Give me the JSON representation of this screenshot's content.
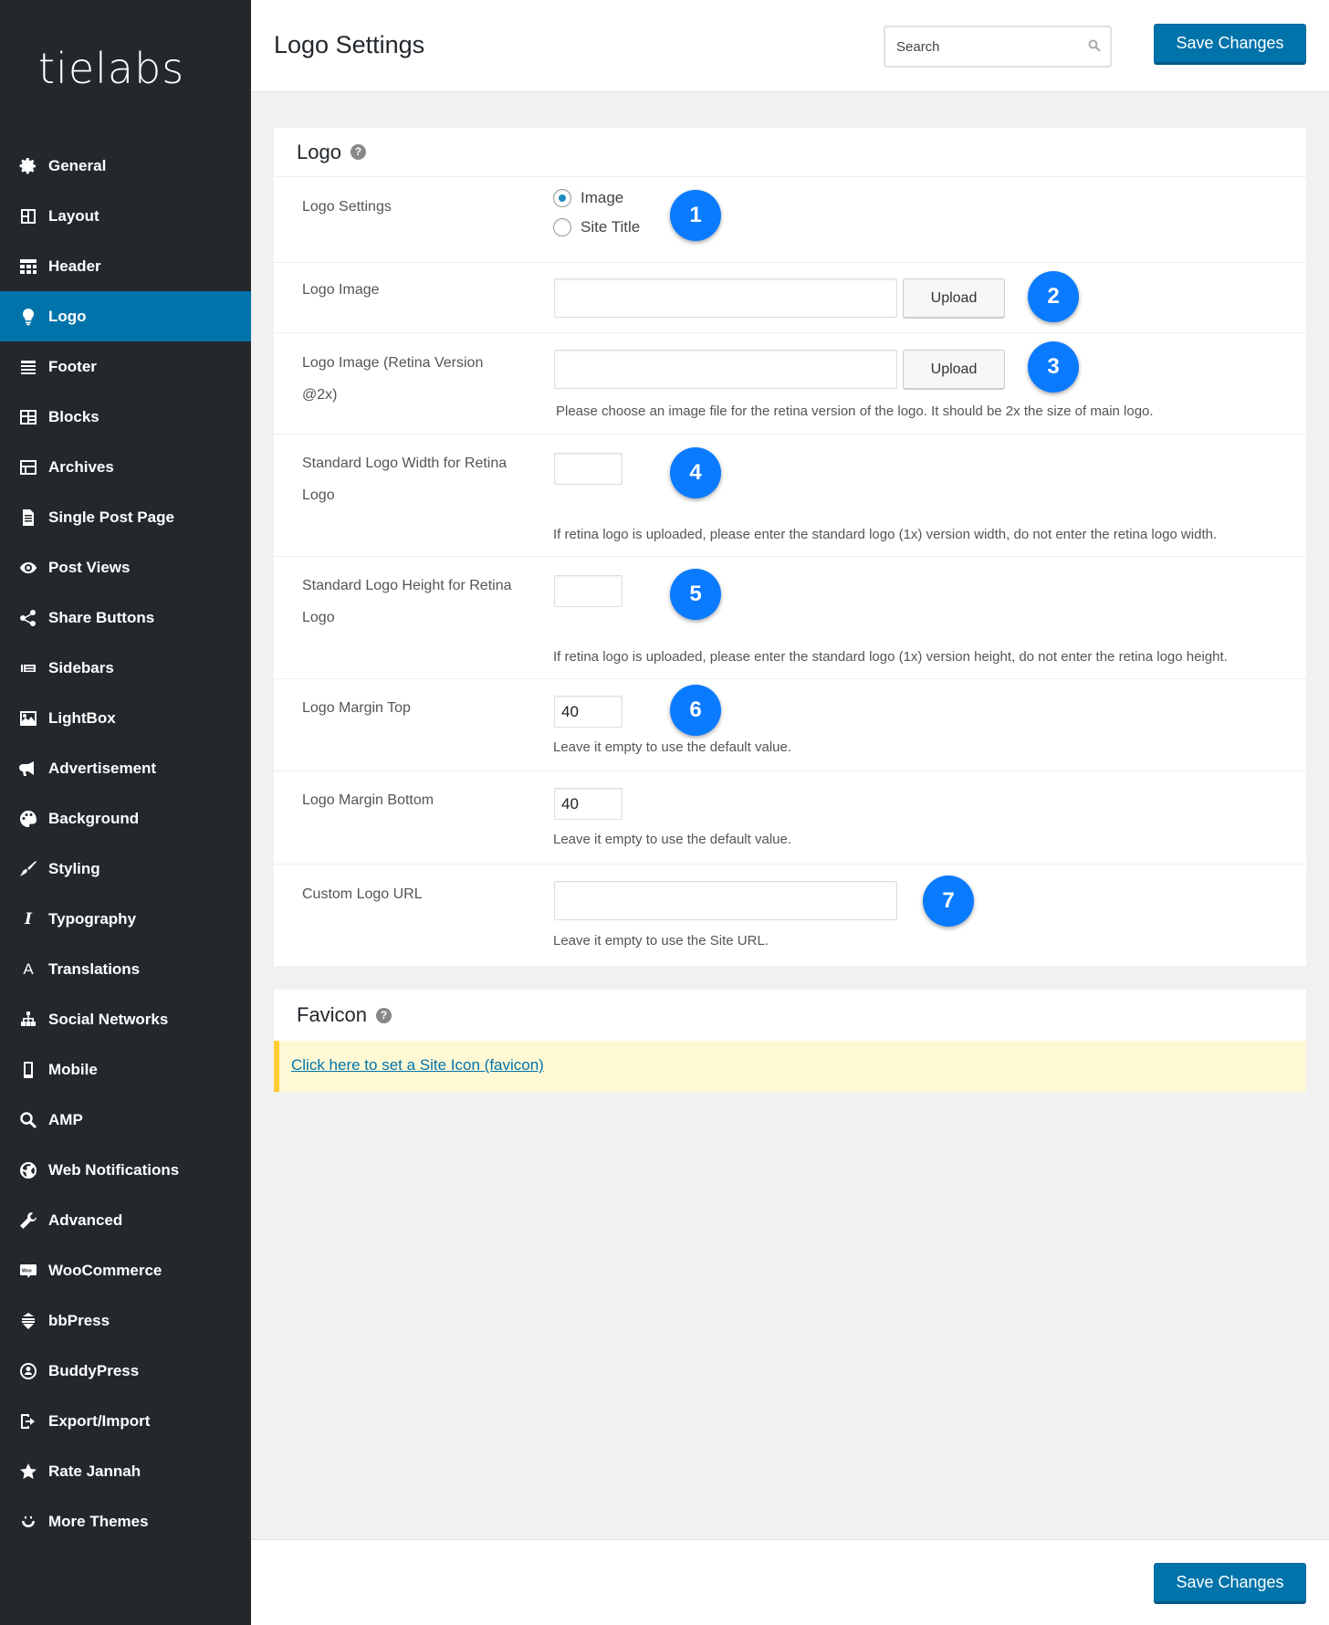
{
  "brand": {
    "logo_text": "tielabs"
  },
  "sidebar": {
    "items": [
      {
        "label": "General",
        "icon": "gear-icon"
      },
      {
        "label": "Layout",
        "icon": "layout-icon"
      },
      {
        "label": "Header",
        "icon": "header-icon"
      },
      {
        "label": "Logo",
        "icon": "lightbulb-icon",
        "active": true
      },
      {
        "label": "Footer",
        "icon": "footer-icon"
      },
      {
        "label": "Blocks",
        "icon": "blocks-icon"
      },
      {
        "label": "Archives",
        "icon": "archives-icon"
      },
      {
        "label": "Single Post Page",
        "icon": "document-icon"
      },
      {
        "label": "Post Views",
        "icon": "eye-icon"
      },
      {
        "label": "Share Buttons",
        "icon": "share-icon"
      },
      {
        "label": "Sidebars",
        "icon": "sidebars-icon"
      },
      {
        "label": "LightBox",
        "icon": "image-icon"
      },
      {
        "label": "Advertisement",
        "icon": "megaphone-icon"
      },
      {
        "label": "Background",
        "icon": "palette-icon"
      },
      {
        "label": "Styling",
        "icon": "brush-icon"
      },
      {
        "label": "Typography",
        "icon": "italic-icon"
      },
      {
        "label": "Translations",
        "icon": "translate-icon"
      },
      {
        "label": "Social Networks",
        "icon": "network-icon"
      },
      {
        "label": "Mobile",
        "icon": "mobile-icon"
      },
      {
        "label": "AMP",
        "icon": "search-icon"
      },
      {
        "label": "Web Notifications",
        "icon": "globe-icon"
      },
      {
        "label": "Advanced",
        "icon": "wrench-icon"
      },
      {
        "label": "WooCommerce",
        "icon": "woo-icon"
      },
      {
        "label": "bbPress",
        "icon": "bbpress-icon"
      },
      {
        "label": "BuddyPress",
        "icon": "buddypress-icon"
      },
      {
        "label": "Export/Import",
        "icon": "export-icon"
      },
      {
        "label": "Rate Jannah",
        "icon": "star-icon"
      },
      {
        "label": "More Themes",
        "icon": "smile-icon"
      }
    ]
  },
  "header": {
    "title": "Logo Settings",
    "search_placeholder": "Search",
    "save_label": "Save Changes"
  },
  "logo_panel": {
    "title": "Logo",
    "help": "?",
    "logo_settings": {
      "label": "Logo Settings",
      "options": [
        "Image",
        "Site Title"
      ],
      "selected": "Image"
    },
    "logo_image": {
      "label": "Logo Image",
      "value": "",
      "button": "Upload"
    },
    "logo_retina": {
      "label_line1": "Logo Image (Retina Version",
      "label_line2": "@2x)",
      "value": "",
      "button": "Upload",
      "hint": "Please choose an image file for the retina version of the logo. It should be 2x the size of main logo."
    },
    "logo_width": {
      "label_line1": "Standard Logo Width for Retina",
      "label_line2": "Logo",
      "value": "",
      "hint": "If retina logo is uploaded, please enter the standard logo (1x) version width, do not enter the retina logo width."
    },
    "logo_height": {
      "label_line1": "Standard Logo Height for Retina",
      "label_line2": "Logo",
      "value": "",
      "hint": "If retina logo is uploaded, please enter the standard logo (1x) version height, do not enter the retina logo height."
    },
    "margin_top": {
      "label": "Logo Margin Top",
      "value": "40",
      "hint": "Leave it empty to use the default value."
    },
    "margin_bottom": {
      "label": "Logo Margin Bottom",
      "value": "40",
      "hint": "Leave it empty to use the default value."
    },
    "custom_url": {
      "label": "Custom Logo URL",
      "value": "",
      "hint": "Leave it empty to use the Site URL."
    }
  },
  "badges": [
    "1",
    "2",
    "3",
    "4",
    "5",
    "6",
    "7"
  ],
  "favicon_panel": {
    "title": "Favicon",
    "help": "?",
    "link": "Click here to set a Site Icon (favicon)"
  },
  "footer": {
    "save_label": "Save Changes"
  },
  "colors": {
    "sidebar_bg": "#23282d",
    "accent": "#0073aa",
    "badge": "#0a7bff",
    "notice_bg": "#fff8d5",
    "notice_border": "#ffcc33"
  }
}
